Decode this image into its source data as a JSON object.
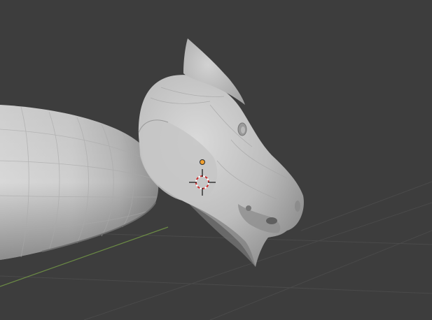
{
  "viewport": {
    "mode": "3d-viewport",
    "background_color": "#3d3d3d",
    "grid_color": "#4a4a4a",
    "x_axis_color": "#7a9a4c",
    "mesh_color": "#b9b9b9",
    "origin_color": "#f0a030",
    "cursor_color": "#cc3030",
    "objects": [
      {
        "name": "body-mesh",
        "shading": "solid",
        "icon": "mesh-icon"
      },
      {
        "name": "head-mesh",
        "shading": "solid",
        "icon": "mesh-icon"
      }
    ],
    "cursor": {
      "icon": "3d-cursor-icon"
    },
    "origin": {
      "icon": "object-origin-icon"
    }
  }
}
